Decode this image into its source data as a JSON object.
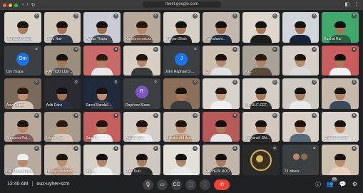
{
  "browser": {
    "url": "meet.google.com",
    "nav_back": "‹",
    "nav_forward": "›",
    "nav_reload": "↻",
    "menu": "⋮"
  },
  "colors": {
    "bg": "#202124",
    "tile": "#3c4043",
    "end_call": "#ea4335",
    "avatar_blue": "#1a73e8",
    "avatar_purple": "#7e57c2"
  },
  "tiles": [
    {
      "name": "Sidhaarth Sawla",
      "bg": "#d9d2c6",
      "skin": "#a87a5a",
      "hair": "#1a1410",
      "shirt": "#d0d0d0"
    },
    {
      "name": "Devu Nair",
      "bg": "#cfc7b9",
      "skin": "#a57456",
      "hair": "#171210",
      "shirt": "#2f3a4a"
    },
    {
      "name": "Abhas Thapa",
      "bg": "#c9cdd3",
      "skin": "#9d6f50",
      "hair": "#151110",
      "shirt": "#4a4f5a"
    },
    {
      "name": "Karishma raichand",
      "bg": "#b7a99a",
      "skin": "#b5876a",
      "hair": "#251810",
      "shirt": "#6b4f45"
    },
    {
      "name": "Shriyan Shah",
      "bg": "#d4d0c8",
      "skin": "#a67a5e",
      "hair": "#121010",
      "shirt": "#222222"
    },
    {
      "name": "Trayodashi...",
      "bg": "#c2b8ad",
      "skin": "#9e6f52",
      "hair": "#141010",
      "shirt": "#1f2b3a"
    },
    {
      "name": "",
      "bg": "#ddd6cb",
      "skin": "#a5775a",
      "hair": "#131010",
      "shirt": "#1c1c1c"
    },
    {
      "name": "",
      "bg": "#cfd5d8",
      "skin": "#a17456",
      "hair": "#161210",
      "shirt": "#15223a"
    },
    {
      "name": "Kushal Rai",
      "bg": "#3fa86a",
      "skin": "#a27658",
      "hair": "#111010",
      "shirt": "#2e5e44"
    },
    {
      "name": "Om Thapa",
      "avatar": "Om",
      "avatar_color": "#1a73e8"
    },
    {
      "name": "RATHOD LUE Rub...",
      "bg": "#9b8e7c",
      "skin": "#a27858",
      "hair": "#161210",
      "shirt": "#545454"
    },
    {
      "name": "",
      "bg": "#c96a6a",
      "skin": "#b08060",
      "hair": "#2a1a12",
      "shirt": "#e6e6e6"
    },
    {
      "name": "",
      "bg": "#d8cfc4",
      "skin": "#b3876a",
      "hair": "#1c1410",
      "shirt": "#3b3b3b"
    },
    {
      "name": "John Raphael Se...",
      "avatar": "J",
      "avatar_color": "#1a73e8"
    },
    {
      "name": "Ca...",
      "bg": "#cbbfb0",
      "skin": "#b58a6c",
      "hair": "#1a1210",
      "shirt": "#e2e2e2"
    },
    {
      "name": "Pa...",
      "bg": "#a9a296",
      "skin": "#b08264",
      "hair": "#2b1a10",
      "shirt": "#5a4a3a"
    },
    {
      "name": "",
      "bg": "#d5cfc7",
      "skin": "#b88c6c",
      "hair": "#1d1410",
      "shirt": "#d9d9d9"
    },
    {
      "name": "",
      "bg": "#c95c5c",
      "skin": "#a97c5c",
      "hair": "#131010",
      "shirt": "#f0f0f0"
    },
    {
      "name": "Anvi Gupta",
      "bg": "#7a6a5a",
      "skin": "#c09070",
      "hair": "#2a1b12",
      "shirt": "#d4c4b4"
    },
    {
      "name": "Aditi Dalvi",
      "bg": "#2a2a30",
      "skin": "#a27456",
      "hair": "#121010",
      "shirt": "#2b3040"
    },
    {
      "name": "Sanvi Mandal...",
      "bg": "#1f2a3a",
      "skin": "#bf9070",
      "hair": "#1a1210",
      "shirt": "#3a3a48"
    },
    {
      "name": "Rajshree Musa",
      "avatar": "R",
      "avatar_color": "#7e57c2"
    },
    {
      "name": "",
      "bg": "#8c6f58",
      "skin": "#a57858",
      "hair": "#161210",
      "shirt": "#3c3c3c"
    },
    {
      "name": "",
      "bg": "#d7d2cc",
      "skin": "#c49a7a",
      "hair": "#241610",
      "shirt": "#efefef"
    },
    {
      "name": "IAC ULC-CEF, MNR",
      "bg": "#d3cec6",
      "skin": "#a37858",
      "hair": "#141010",
      "shirt": "#2a2a2a"
    },
    {
      "name": "",
      "bg": "#cfcac1",
      "skin": "#a57a5a",
      "hair": "#131010",
      "shirt": "#e8e8e8"
    },
    {
      "name": "",
      "bg": "#c6b9ac",
      "skin": "#b08466",
      "hair": "#1d1410",
      "shirt": "#3a4a5a"
    },
    {
      "name": "Shrujana Raj...",
      "bg": "#b7a79a",
      "skin": "#b88a6a",
      "hair": "#1f1510",
      "shirt": "#8a5a5a"
    },
    {
      "name": "Ishani Ravi",
      "bg": "#a89a8c",
      "skin": "#c09272",
      "hair": "#2a1a12",
      "shirt": "#d9c8b8"
    },
    {
      "name": "Saachi...",
      "bg": "#c46060",
      "skin": "#b5886a",
      "hair": "#1d1410",
      "shirt": "#f0f0f0"
    },
    {
      "name": "Anvita Sriv...",
      "bg": "#d4ccc4",
      "skin": "#bb8d6d",
      "hair": "#1d1410",
      "shirt": "#ececec"
    },
    {
      "name": "Shlesha Abhilas...",
      "bg": "#c9beb3",
      "skin": "#b88a6a",
      "hair": "#1f1510",
      "shirt": "#c6a07a"
    },
    {
      "name": "",
      "bg": "#b85a5a",
      "skin": "#ac7e5e",
      "hair": "#141010",
      "shirt": "#e5e5e5"
    },
    {
      "name": "Shriyansh Shi...",
      "bg": "#d2c8bd",
      "skin": "#a67a5a",
      "hair": "#141010",
      "shirt": "#2a2a2a"
    },
    {
      "name": "",
      "bg": "#d8d0c6",
      "skin": "#b08466",
      "hair": "#1a1210",
      "shirt": "#5a6a7a"
    },
    {
      "name": "Chadrick Ferrer",
      "bg": "#d9d3cc",
      "skin": "#c3966f",
      "hair": "#1a1210",
      "shirt": "#e0e0e0"
    },
    {
      "name": "Bal Shrina Uchar...",
      "bg": "#b7ab9f",
      "skin": "#b88a6a",
      "hair": "#efefef",
      "shirt": "#f2f2f2"
    },
    {
      "name": "Hiranya Nandan...",
      "bg": "#c8bbb0",
      "skin": "#bb8d6d",
      "hair": "#1d1410",
      "shirt": "#c4a08a"
    },
    {
      "name": "Imas...",
      "bg": "#d5d0c8",
      "skin": "#b08466",
      "hair": "#141010",
      "shirt": "#ececec"
    },
    {
      "name": "Purv Dutt...",
      "bg": "#cfc8c0",
      "skin": "#a87c5c",
      "hair": "#141010",
      "shirt": "#2a2a2a"
    },
    {
      "name": "",
      "bg": "#e3e0da",
      "skin": "#b08466",
      "hair": "#141010",
      "shirt": "#e8e8e8"
    },
    {
      "name": "MATHEW RODRIGUES",
      "bg": "#c2b6aa",
      "skin": "#a87c5c",
      "hair": "#141010",
      "shirt": "#3a3a3a"
    },
    {
      "name": "",
      "bg": "#2a2a2a",
      "emblem": true
    },
    {
      "name": "23 others",
      "avatar": "",
      "others": true,
      "avatar_color": "#3c4043"
    },
    {
      "name": "",
      "bg": "#cdbfae",
      "skin": "#bb8d6d",
      "hair": "#1d1410",
      "shirt": "#e8d0c0"
    }
  ],
  "bottom_bar": {
    "time": "12:40 AM",
    "separator": "|",
    "meeting_code": "ouz-uyher-scm",
    "controls": [
      {
        "name": "mic-button",
        "glyph": "🎙"
      },
      {
        "name": "camera-button",
        "glyph": "▭"
      },
      {
        "name": "captions-button",
        "glyph": "CC"
      },
      {
        "name": "present-button",
        "glyph": "⬚"
      },
      {
        "name": "more-options-button",
        "glyph": "⋮"
      }
    ],
    "end_call_glyph": "✆",
    "right_icons": {
      "info": "ⓘ",
      "people": "👥",
      "chat": "💬",
      "activities": "⚙",
      "people_count": "65"
    }
  }
}
